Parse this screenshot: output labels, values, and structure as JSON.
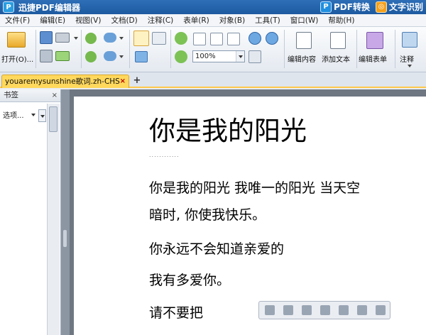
{
  "app": {
    "title": "迅捷PDF编辑器",
    "logo_glyph": "P",
    "pdf_convert_label": "PDF转换",
    "ocr_label": "文字识别"
  },
  "menu": [
    "文件(F)",
    "编辑(E)",
    "视图(V)",
    "文档(D)",
    "注释(C)",
    "表单(R)",
    "对象(B)",
    "工具(T)",
    "窗口(W)",
    "帮助(H)"
  ],
  "toolbar": {
    "open_label": "打开(O)...",
    "zoom_value": "100%",
    "edit_content_label": "编辑内容",
    "add_text_label": "添加文本",
    "edit_form_label": "编辑表单",
    "annotate_label": "注释"
  },
  "tab": {
    "label": "youaremysunshine歌词.zh-CHS",
    "close_glyph": "×",
    "add_glyph": "+"
  },
  "bookmarks": {
    "title": "书签",
    "close_glyph": "×",
    "options_label": "选项..."
  },
  "document": {
    "title": "你是我的阳光",
    "title_rule": "............",
    "lines": [
      "你是我的阳光 我唯一的阳光 当天空",
      "暗时, 你使我快乐。",
      "你永远不会知道亲爱的",
      "我有多爱你。",
      "请不要把"
    ]
  },
  "colors": {
    "titlebar": "#1d5aa0",
    "tab_active": "#ffd85c",
    "doc_background": "#6e7782"
  }
}
